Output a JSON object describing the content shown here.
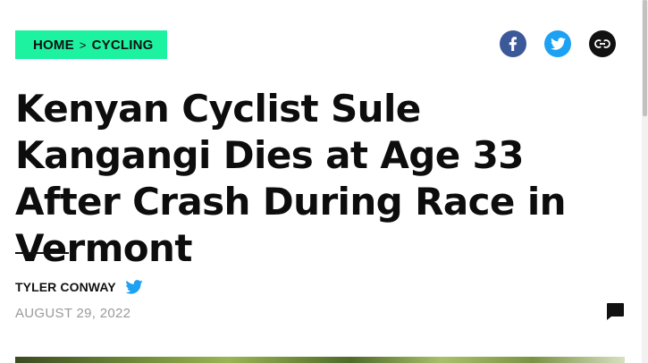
{
  "breadcrumb": {
    "home": "HOME",
    "separator": ">",
    "section": "CYCLING"
  },
  "share": {
    "facebook_icon": "facebook-icon",
    "twitter_icon": "twitter-icon",
    "link_icon": "link-icon"
  },
  "article": {
    "headline": "Kenyan Cyclist Sule Kangangi Dies at Age 33 After Crash During Race in Vermont",
    "author": "TYLER CONWAY",
    "date": "AUGUST 29, 2022"
  },
  "colors": {
    "breadcrumb_bg": "#1cf2a0",
    "facebook": "#3b5998",
    "twitter": "#1da1f2",
    "date_text": "#9a9a9a"
  }
}
